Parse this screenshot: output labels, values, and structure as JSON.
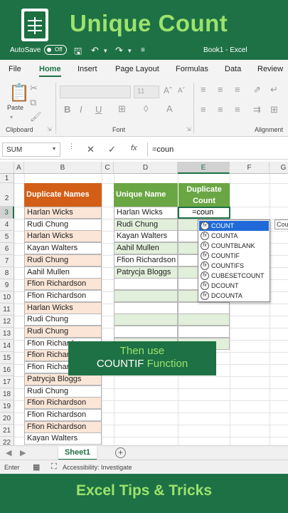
{
  "banner": {
    "title": "Unique Count"
  },
  "footer": {
    "title": "Excel Tips & Tricks"
  },
  "qat": {
    "autosave": "AutoSave",
    "toggle": "Off",
    "book": "Book1  -  Excel"
  },
  "menu": [
    "File",
    "Home",
    "Insert",
    "Page Layout",
    "Formulas",
    "Data",
    "Review"
  ],
  "ribbon": {
    "paste": "Paste",
    "clipboard": "Clipboard",
    "font": "Font",
    "alignment": "Alignment",
    "size": "11"
  },
  "formula_bar": {
    "name_box": "SUM",
    "content": "=coun"
  },
  "columns": [
    "A",
    "B",
    "C",
    "D",
    "E",
    "F",
    "G"
  ],
  "rows": [
    "1",
    "2",
    "3",
    "4",
    "5",
    "6",
    "7",
    "8",
    "9",
    "10",
    "11",
    "12",
    "13",
    "14",
    "15",
    "16",
    "17",
    "18",
    "19",
    "20",
    "21",
    "22"
  ],
  "table1": {
    "header": "Duplicate Names",
    "names": [
      "Harlan Wicks",
      "Rudi Chung",
      "Harlan Wicks",
      "Kayan Walters",
      "Rudi Chung",
      "Aahil Mullen",
      "Ffion Richardson",
      "Ffion Richardson",
      "Harlan Wicks",
      "Rudi Chung",
      "Rudi Chung",
      "Ffion Richardson",
      "Ffion Richardson",
      "Ffion Richardson",
      "Patrycja Bloggs",
      "Rudi Chung",
      "Ffion Richardson",
      "Ffion Richardson",
      "Ffion Richardson",
      "Kayan Walters"
    ],
    "highlighted": [
      true,
      false,
      true,
      false,
      true,
      false,
      true,
      false,
      true,
      false,
      true,
      false,
      true,
      false,
      true,
      false,
      true,
      false,
      true,
      false
    ]
  },
  "table2": {
    "header_name": "Unique Name",
    "header_count_line1": "Duplicate",
    "header_count_line2": "Count",
    "names": [
      "Harlan Wicks",
      "Rudi Chung",
      "Kayan Walters",
      "Aahil Mullen",
      "Ffion Richardson",
      "Patrycja Bloggs",
      "",
      "",
      "",
      "",
      "",
      ""
    ],
    "active_input": "=coun"
  },
  "autocomplete": {
    "items": [
      "COUNT",
      "COUNTA",
      "COUNTBLANK",
      "COUNTIF",
      "COUNTIFS",
      "CUBESETCOUNT",
      "DCOUNT",
      "DCOUNTA"
    ],
    "selected_index": 0,
    "tooltip": "Cou"
  },
  "overlay": {
    "line1": "Then use",
    "line2_white": "COUNTIF ",
    "line2_green": "Function"
  },
  "sheets": {
    "active": "Sheet1"
  },
  "status": {
    "mode": "Enter",
    "accessibility": "Accessibility: Investigate"
  },
  "colors": {
    "excel_green": "#1e7145",
    "accent_green": "#9be36d",
    "orange": "#d35f17",
    "table_green": "#6aa744",
    "row_highlight": "#fbe5d6",
    "alt_green": "#e2efda"
  }
}
